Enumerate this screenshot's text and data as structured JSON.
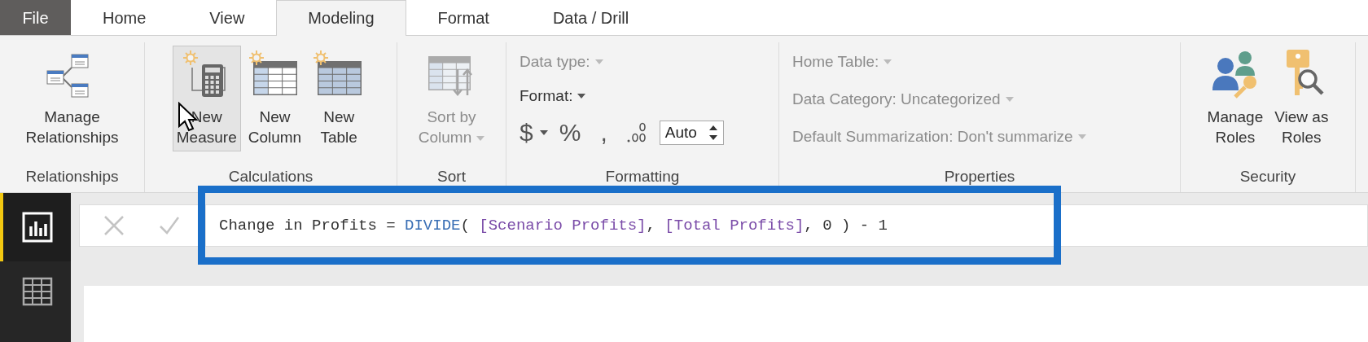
{
  "tabs": [
    {
      "label": "File",
      "kind": "file",
      "selected": false
    },
    {
      "label": "Home",
      "kind": "tab",
      "selected": false
    },
    {
      "label": "View",
      "kind": "tab",
      "selected": false
    },
    {
      "label": "Modeling",
      "kind": "tab",
      "selected": true
    },
    {
      "label": "Format",
      "kind": "tab",
      "selected": false
    },
    {
      "label": "Data / Drill",
      "kind": "tab",
      "selected": false
    }
  ],
  "ribbon": {
    "groups": [
      {
        "label": "Relationships",
        "kind": "buttons",
        "buttons": [
          {
            "lines": [
              "Manage",
              "Relationships"
            ],
            "kind": "relationships",
            "highlighted": false,
            "disabled": false,
            "dropdown": false
          }
        ]
      },
      {
        "label": "Calculations",
        "kind": "buttons",
        "buttons": [
          {
            "lines": [
              "New",
              "Measure"
            ],
            "kind": "measure",
            "highlighted": true,
            "disabled": false,
            "dropdown": false
          },
          {
            "lines": [
              "New",
              "Column"
            ],
            "kind": "column",
            "highlighted": false,
            "disabled": false,
            "dropdown": false
          },
          {
            "lines": [
              "New",
              "Table"
            ],
            "kind": "table",
            "highlighted": false,
            "disabled": false,
            "dropdown": false
          }
        ]
      },
      {
        "label": "Sort",
        "kind": "buttons",
        "buttons": [
          {
            "lines": [
              "Sort by",
              "Column"
            ],
            "kind": "sort",
            "highlighted": false,
            "disabled": true,
            "dropdown": true
          }
        ]
      },
      {
        "label": "Formatting",
        "kind": "formatting",
        "data_type": {
          "label": "Data type:",
          "disabled": true
        },
        "format": {
          "label": "Format:",
          "disabled": false
        },
        "currency": "$",
        "percent": "%",
        "comma": ",",
        "decimal_places": "Auto"
      },
      {
        "label": "Properties",
        "kind": "fields",
        "fields": [
          {
            "label": "Home Table:",
            "disabled": true
          },
          {
            "label": "Data Category: Uncategorized",
            "disabled": true
          },
          {
            "label": "Default Summarization: Don't summarize",
            "disabled": true
          }
        ]
      },
      {
        "label": "Security",
        "kind": "buttons",
        "buttons": [
          {
            "lines": [
              "Manage",
              "Roles"
            ],
            "kind": "roles",
            "highlighted": false,
            "disabled": false,
            "dropdown": false
          },
          {
            "lines": [
              "View as",
              "Roles"
            ],
            "kind": "view-roles",
            "highlighted": false,
            "disabled": false,
            "dropdown": false
          }
        ]
      }
    ]
  },
  "sidebar": [
    {
      "kind": "report",
      "selected": true
    },
    {
      "kind": "data",
      "selected": false
    }
  ],
  "formula": {
    "highlighted": true,
    "segments": [
      {
        "kind": "plain",
        "text": "Change in Profits = "
      },
      {
        "kind": "function",
        "text": "DIVIDE"
      },
      {
        "kind": "plain",
        "text": "( "
      },
      {
        "kind": "column",
        "text": "[Scenario Profits]"
      },
      {
        "kind": "plain",
        "text": ", "
      },
      {
        "kind": "column",
        "text": "[Total Profits]"
      },
      {
        "kind": "plain",
        "text": ", 0 ) - 1"
      }
    ]
  }
}
